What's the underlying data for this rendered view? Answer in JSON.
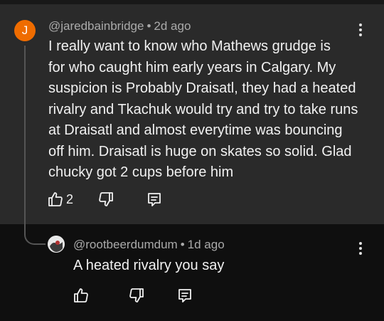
{
  "comment": {
    "avatar_letter": "J",
    "avatar_color": "#ef6c00",
    "author": "@jaredbainbridge",
    "separator": "•",
    "time": "2d ago",
    "lines": [
      "I really want to know who Mathews grudge is",
      "for who caught him early years in Calgary. My",
      "suspicion is Probably Draisatl, they had a heated",
      "rivalry and Tkachuk would try and try to take runs",
      "at Draisatl and almost everytime was bouncing",
      "off him. Draisatl is huge on skates so solid. Glad",
      "chucky got 2 cups before him"
    ],
    "like_count": "2",
    "icons": {
      "more": "more-vertical-icon",
      "like": "thumbs-up-icon",
      "dislike": "thumbs-down-icon",
      "reply": "reply-comment-icon"
    }
  },
  "reply": {
    "author": "@rootbeerdumdum",
    "separator": "•",
    "time": "1d ago",
    "text": "A heated rivalry you say",
    "icons": {
      "more": "more-vertical-icon",
      "like": "thumbs-up-icon",
      "dislike": "thumbs-down-icon",
      "reply": "reply-comment-icon"
    }
  },
  "colors": {
    "highlight_bg": "#2a2a2a",
    "page_bg": "#0f0f0f",
    "meta_text": "#aaaaaa",
    "body_text": "#f1f1f1"
  }
}
